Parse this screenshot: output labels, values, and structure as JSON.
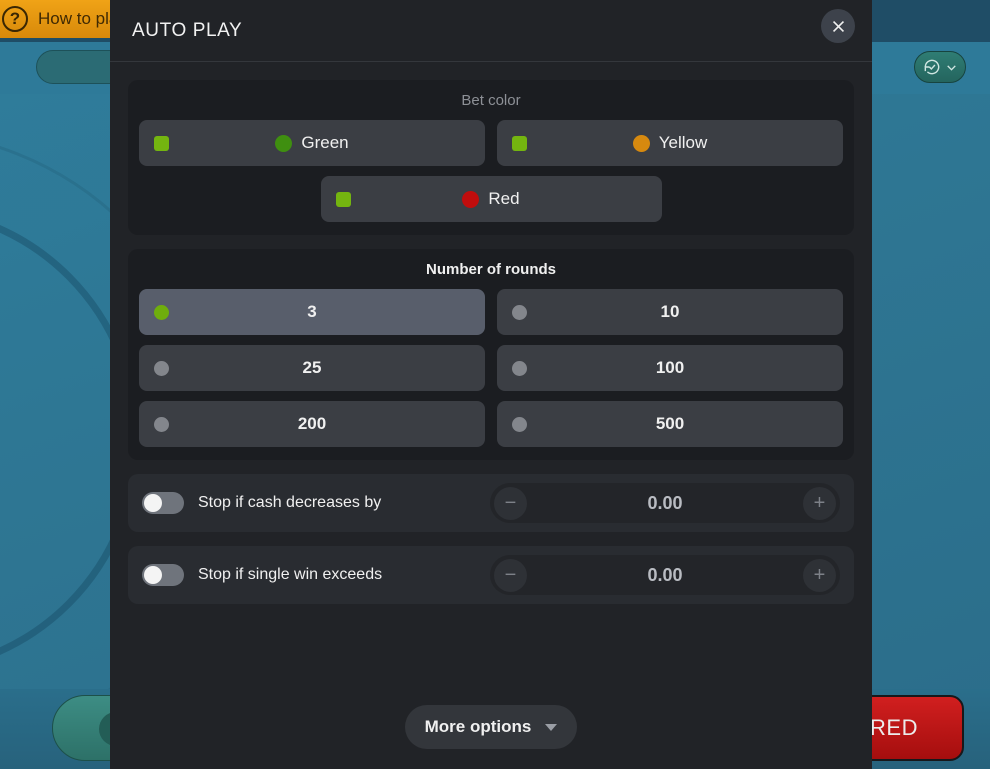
{
  "background": {
    "howto_banner": {
      "label": "How to play",
      "icon": "question-mark-icon",
      "bg_color": "#e89c14"
    },
    "history_button": {
      "icon": "history-check-icon",
      "chevron": "chevron-down-icon"
    },
    "red_bet_button": {
      "label": "RED",
      "color": "#c01a1a"
    },
    "table_color": "#2e7693"
  },
  "modal": {
    "title": "AUTO PLAY",
    "close_icon": "close-icon",
    "bet_color": {
      "title": "Bet color",
      "options": [
        {
          "label": "Green",
          "swatch": "#3f8f10",
          "marker": "square",
          "selected": true
        },
        {
          "label": "Yellow",
          "swatch": "#d6890f",
          "marker": "square",
          "selected": true
        },
        {
          "label": "Red",
          "swatch": "#c00d0d",
          "marker": "square",
          "selected": true
        }
      ]
    },
    "rounds": {
      "title": "Number of rounds",
      "options": [
        {
          "label": "3",
          "selected": true
        },
        {
          "label": "10",
          "selected": false
        },
        {
          "label": "25",
          "selected": false
        },
        {
          "label": "100",
          "selected": false
        },
        {
          "label": "200",
          "selected": false
        },
        {
          "label": "500",
          "selected": false
        }
      ]
    },
    "limits": [
      {
        "label": "Stop if cash decreases by",
        "enabled": false,
        "value": "0.00",
        "minus": "−",
        "plus": "+"
      },
      {
        "label": "Stop if single win exceeds",
        "enabled": false,
        "value": "0.00",
        "minus": "−",
        "plus": "+"
      }
    ],
    "more_options_label": "More options",
    "accent_green": "#74b510",
    "selected_row_bg": "#585e6b"
  }
}
